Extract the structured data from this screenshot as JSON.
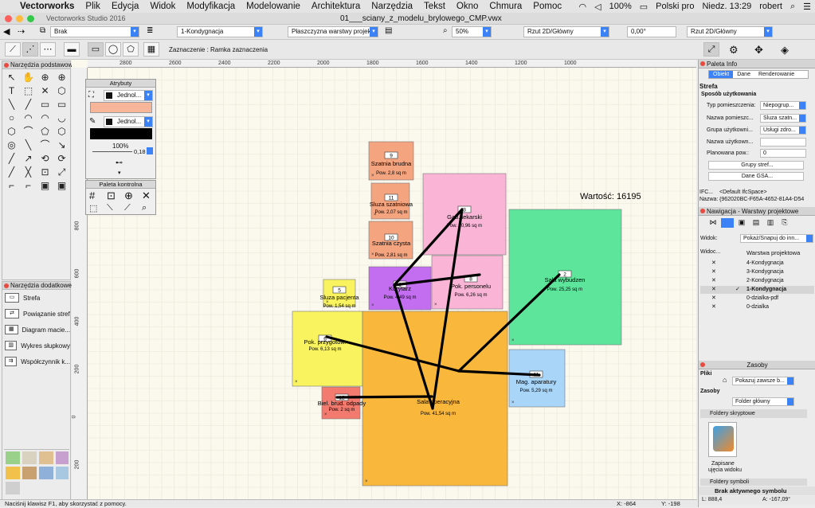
{
  "menubar": {
    "app": "Vectorworks",
    "items": [
      "Plik",
      "Edycja",
      "Widok",
      "Modyfikacja",
      "Modelowanie",
      "Architektura",
      "Narzędzia",
      "Tekst",
      "Okno",
      "Chmura",
      "Pomoc"
    ],
    "battery": "100%",
    "language": "Polski pro",
    "clock": "Niedz. 13:29",
    "user": "robert"
  },
  "window": {
    "app_title": "Vectorworks Studio 2016",
    "doc_title": "01___sciany_z_modelu_brylowego_CMP.vwx"
  },
  "toolbar1": {
    "class_value": "Brak",
    "layer_value": "1-Kondygnacja",
    "plane_value": "Płaszczyzna warstwy projek...",
    "zoom_value": "50%",
    "view_value": "Rzut 2D/Główny",
    "angle_value": "0,00°",
    "render_value": "Rzut 2D/Główny"
  },
  "toolbar2": {
    "mode_label": "Zaznaczenie : Ramka zaznaczenia"
  },
  "left_tools": {
    "title": "Narzędzia podstawowe",
    "glyphs": [
      "↖",
      "✋",
      "⊕",
      "⊕",
      "T",
      "⬚",
      "✕",
      "⬡",
      "╲",
      "╱",
      "▭",
      "▭",
      "○",
      "◠",
      "◠",
      "◡",
      "⬡",
      "⌒",
      "⬠",
      "⬡",
      "◎",
      "╲",
      "⌒",
      "↘",
      "╱",
      "↗",
      "⟲",
      "⟳",
      "╱",
      "╳",
      "⊡",
      "⤢",
      "⌐",
      "⌐",
      "▣",
      "▣"
    ]
  },
  "add_tools": {
    "title": "Narzędzia dodatkowe",
    "items": [
      "Strefa",
      "Powiązanie stref",
      "Diagram macie...",
      "Wykres słupkowy",
      "Współczynnik k..."
    ]
  },
  "attributes": {
    "title": "Atrybuty",
    "fill_label": "Jednol...",
    "fill_color": "#f7b59a",
    "pen_label": "Jednol...",
    "opacity": "100%",
    "thickness": "0,18"
  },
  "palette_control": {
    "title": "Paleta kontrolna"
  },
  "canvas": {
    "value_label": "Wartość: 16195",
    "hruler_labels": [
      "2800",
      "2600",
      "2400",
      "2200",
      "2000",
      "1800",
      "1600",
      "1400",
      "1200",
      "1000"
    ],
    "vruler_labels": [
      "800",
      "600",
      "400",
      "200",
      "0",
      "200",
      "400"
    ],
    "rooms": [
      {
        "num": "9",
        "name": "Szatnia brudna",
        "area": "Pow. 2,8 sq m",
        "color": "#f4a47f"
      },
      {
        "num": "11",
        "name": "Sluza szatniowa",
        "area": "Pow. 2,07 sq m",
        "color": "#f4a47f"
      },
      {
        "num": "10",
        "name": "Szatnia czysta",
        "area": "Pow. 2,81 sq m",
        "color": "#f4a47f"
      },
      {
        "num": "3",
        "name": "Gab. lekarski",
        "area": "Pow. 10,96 sq m",
        "color": "#f9b4d6"
      },
      {
        "num": "8",
        "name": "Pok. personelu",
        "area": "Pow. 6,26 sq m",
        "color": "#f9b4d6"
      },
      {
        "num": "2",
        "name": "Sala wybudzen",
        "area": "Pow. 25,25 sq m",
        "color": "#5ee59c"
      },
      {
        "num": "1",
        "name": "Korytarz",
        "area": "Pow. 4,49 sq m",
        "color": "#c36df0"
      },
      {
        "num": "5",
        "name": "Sluza pacjenta",
        "area": "Pow. 1,54 sq m",
        "color": "#f8f35f"
      },
      {
        "num": "6",
        "name": "Pok. przygotow.",
        "area": "Pow. 6,13 sq m",
        "color": "#f8f35f"
      },
      {
        "num": "",
        "name": "Sala operacyjna",
        "area": "Pow. 41,54 sq m",
        "color": "#f9b73c"
      },
      {
        "num": "11",
        "name": "Mag. aparatury",
        "area": "Pow. 5,29 sq m",
        "color": "#a9d5f8"
      },
      {
        "num": "12",
        "name": "Biel. brud. odpady",
        "area": "Pow. 2 sq m",
        "color": "#f37a6e"
      }
    ]
  },
  "status": {
    "hint": "Naciśnij klawisz F1, aby skorzystać z pomocy.",
    "x": "X: -864",
    "y": "Y: -198",
    "l": "L: 888,4",
    "angle": "A: -167,09°"
  },
  "palette_info": {
    "title": "Paleta Info",
    "tabs": [
      "Obiekt",
      "Dane",
      "Renderowanie"
    ],
    "object_type": "Strefa",
    "section": "Sposób użytkowania",
    "fields": [
      {
        "label": "Typ pomieszczenia:",
        "value": "Niepogrup..."
      },
      {
        "label": "Nazwa pomieszc...",
        "value": "Sluza szatn..."
      },
      {
        "label": "Grupa użytkowni...",
        "value": "Usługi zdro..."
      },
      {
        "label": "Nazwa użytkown...",
        "value": ""
      },
      {
        "label": "Planowana pow.:",
        "value": "0"
      }
    ],
    "btn1": "Grupy stref...",
    "btn2": "Dane GSA...",
    "ifc_label": "IFC...",
    "ifc_value": "<Default IfcSpace>",
    "name_label": "Nazwa:",
    "name_value": "{962020BC-F65A-4652-81A4-D54"
  },
  "navigation": {
    "title": "Nawigacja - Warstwy projektowe",
    "view_label": "Widok:",
    "view_value": "Pokaż/Snapuj do inn...",
    "col1": "Widoc...",
    "col2": "Warstwa projektowa",
    "layers": [
      "4-Kondygnacja",
      "3-Kondygnacja",
      "2-Kondygnacja",
      "1-Kondygnacja",
      "0-dzialka-pdf",
      "0-dzialka"
    ]
  },
  "resources": {
    "title": "Zasoby",
    "files_label": "Pliki",
    "files_value": "Pokazuj zawsze b...",
    "res_label": "Zasoby",
    "res_value": "Folder główny",
    "folder1": "Foldery skryptowe",
    "item_label1": "Zapisane",
    "item_label2": "ujęcia widoku",
    "folder2": "Foldery symboli",
    "bottom": "Brak aktywnego symbolu"
  }
}
